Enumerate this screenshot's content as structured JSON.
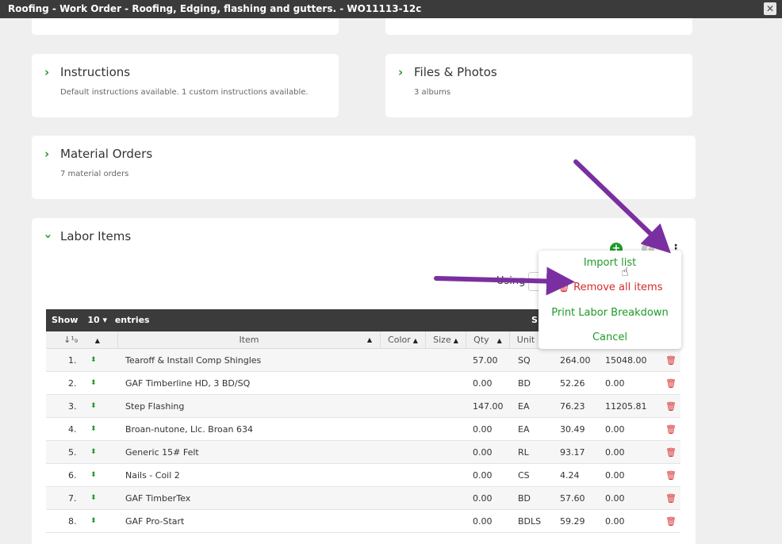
{
  "window": {
    "title": "Roofing - Work Order - Roofing, Edging, flashing and gutters. - WO11113-12c",
    "close_glyph": "✕"
  },
  "cards": {
    "instructions": {
      "title": "Instructions",
      "subtitle": "Default instructions available. 1 custom instructions available."
    },
    "files": {
      "title": "Files & Photos",
      "subtitle": "3 albums"
    },
    "material_orders": {
      "title": "Material Orders",
      "subtitle": "7 material orders"
    },
    "labor_items": {
      "title": "Labor Items"
    }
  },
  "toolbar": {
    "using_label": "Using"
  },
  "table": {
    "show_label": "Show",
    "page_size": "10",
    "entries_label": "entries",
    "search_label": "S",
    "columns": [
      "",
      "Item",
      "Color",
      "Size",
      "Qty",
      "Unit"
    ],
    "rows": [
      {
        "num": "1.",
        "item": "Tearoff & Install Comp Shingles",
        "qty": "57.00",
        "unit": "SQ",
        "price": "264.00",
        "total": "15048.00"
      },
      {
        "num": "2.",
        "item": "GAF Timberline HD, 3 BD/SQ",
        "qty": "0.00",
        "unit": "BD",
        "price": "52.26",
        "total": "0.00"
      },
      {
        "num": "3.",
        "item": "Step Flashing",
        "qty": "147.00",
        "unit": "EA",
        "price": "76.23",
        "total": "11205.81"
      },
      {
        "num": "4.",
        "item": "Broan-nutone, Llc. Broan 634",
        "qty": "0.00",
        "unit": "EA",
        "price": "30.49",
        "total": "0.00"
      },
      {
        "num": "5.",
        "item": "Generic 15# Felt",
        "qty": "0.00",
        "unit": "RL",
        "price": "93.17",
        "total": "0.00"
      },
      {
        "num": "6.",
        "item": "Nails - Coil 2",
        "qty": "0.00",
        "unit": "CS",
        "price": "4.24",
        "total": "0.00"
      },
      {
        "num": "7.",
        "item": "GAF TimberTex",
        "qty": "0.00",
        "unit": "BD",
        "price": "57.60",
        "total": "0.00"
      },
      {
        "num": "8.",
        "item": "GAF Pro-Start",
        "qty": "0.00",
        "unit": "BDLS",
        "price": "59.29",
        "total": "0.00"
      }
    ]
  },
  "menu": {
    "import": "Import list",
    "remove": "Remove all items",
    "print": "Print Labor Breakdown",
    "cancel": "Cancel"
  },
  "colors": {
    "accent_green": "#1e9a28",
    "danger_red": "#d42b2b",
    "annotation_purple": "#7a2fa0",
    "titlebar": "#3b3b3b"
  }
}
